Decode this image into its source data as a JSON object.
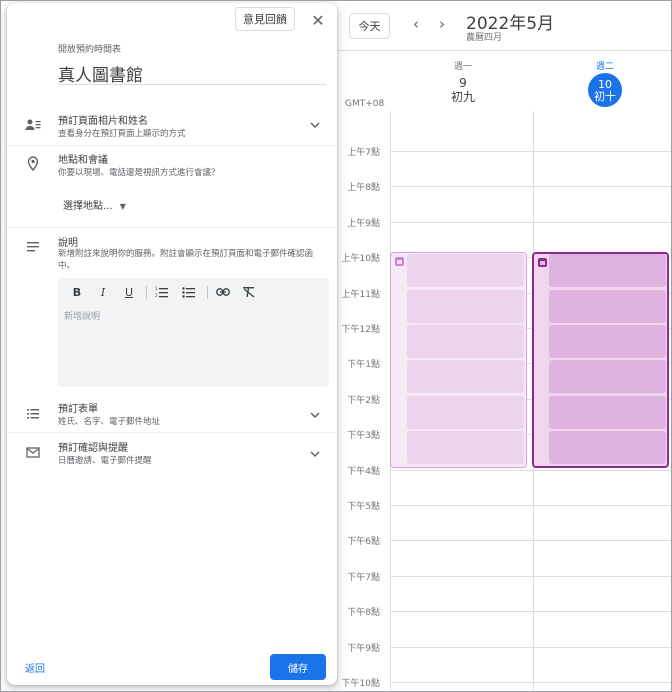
{
  "panel": {
    "feedback_label": "意見回饋",
    "close_glyph": "✕",
    "subtitle": "開放預約時間表",
    "title": "真人圖書館",
    "rows": {
      "profile": {
        "title": "預訂頁面相片和姓名",
        "sub": "查看身分在預訂頁面上顯示的方式"
      },
      "location": {
        "title": "地點和會議",
        "sub": "你要以現場、電話還是視訊方式進行會議？"
      },
      "description": {
        "title": "說明",
        "sub": "新增附註來說明你的服務。附註會顯示在預訂頁面和電子郵件確認函中。"
      },
      "form": {
        "title": "預訂表單",
        "sub": "姓氏、名字、電子郵件地址"
      },
      "confirmation": {
        "title": "預訂確認與提醒",
        "sub": "日曆邀請、電子郵件提醒"
      }
    },
    "location_select": "選擇地點...",
    "editor_placeholder": "新增說明",
    "toolbar": {
      "bold": "B",
      "italic": "I",
      "underline": "U"
    },
    "back_label": "返回",
    "save_label": "儲存"
  },
  "calendar": {
    "today_label": "今天",
    "month_title": "2022年5月",
    "lunar_month": "農曆四月",
    "timezone": "GMT+08",
    "days": [
      {
        "dow": "週一",
        "num": "9",
        "lunar": "初九"
      },
      {
        "dow": "週二",
        "num": "10",
        "lunar": "初十"
      }
    ],
    "hours": [
      "上午7點",
      "上午8點",
      "上午9點",
      "上午10點",
      "上午11點",
      "下午12點",
      "下午1點",
      "下午2點",
      "下午3點",
      "下午4點",
      "下午5點",
      "下午6點",
      "下午7點",
      "下午8點",
      "下午9點",
      "下午10點"
    ],
    "colors": {
      "accent": "#1a73e8",
      "slot_light": "#ecd5ec",
      "slot_selected": "#dfb3df",
      "selected_border": "#8e2b8e"
    }
  }
}
